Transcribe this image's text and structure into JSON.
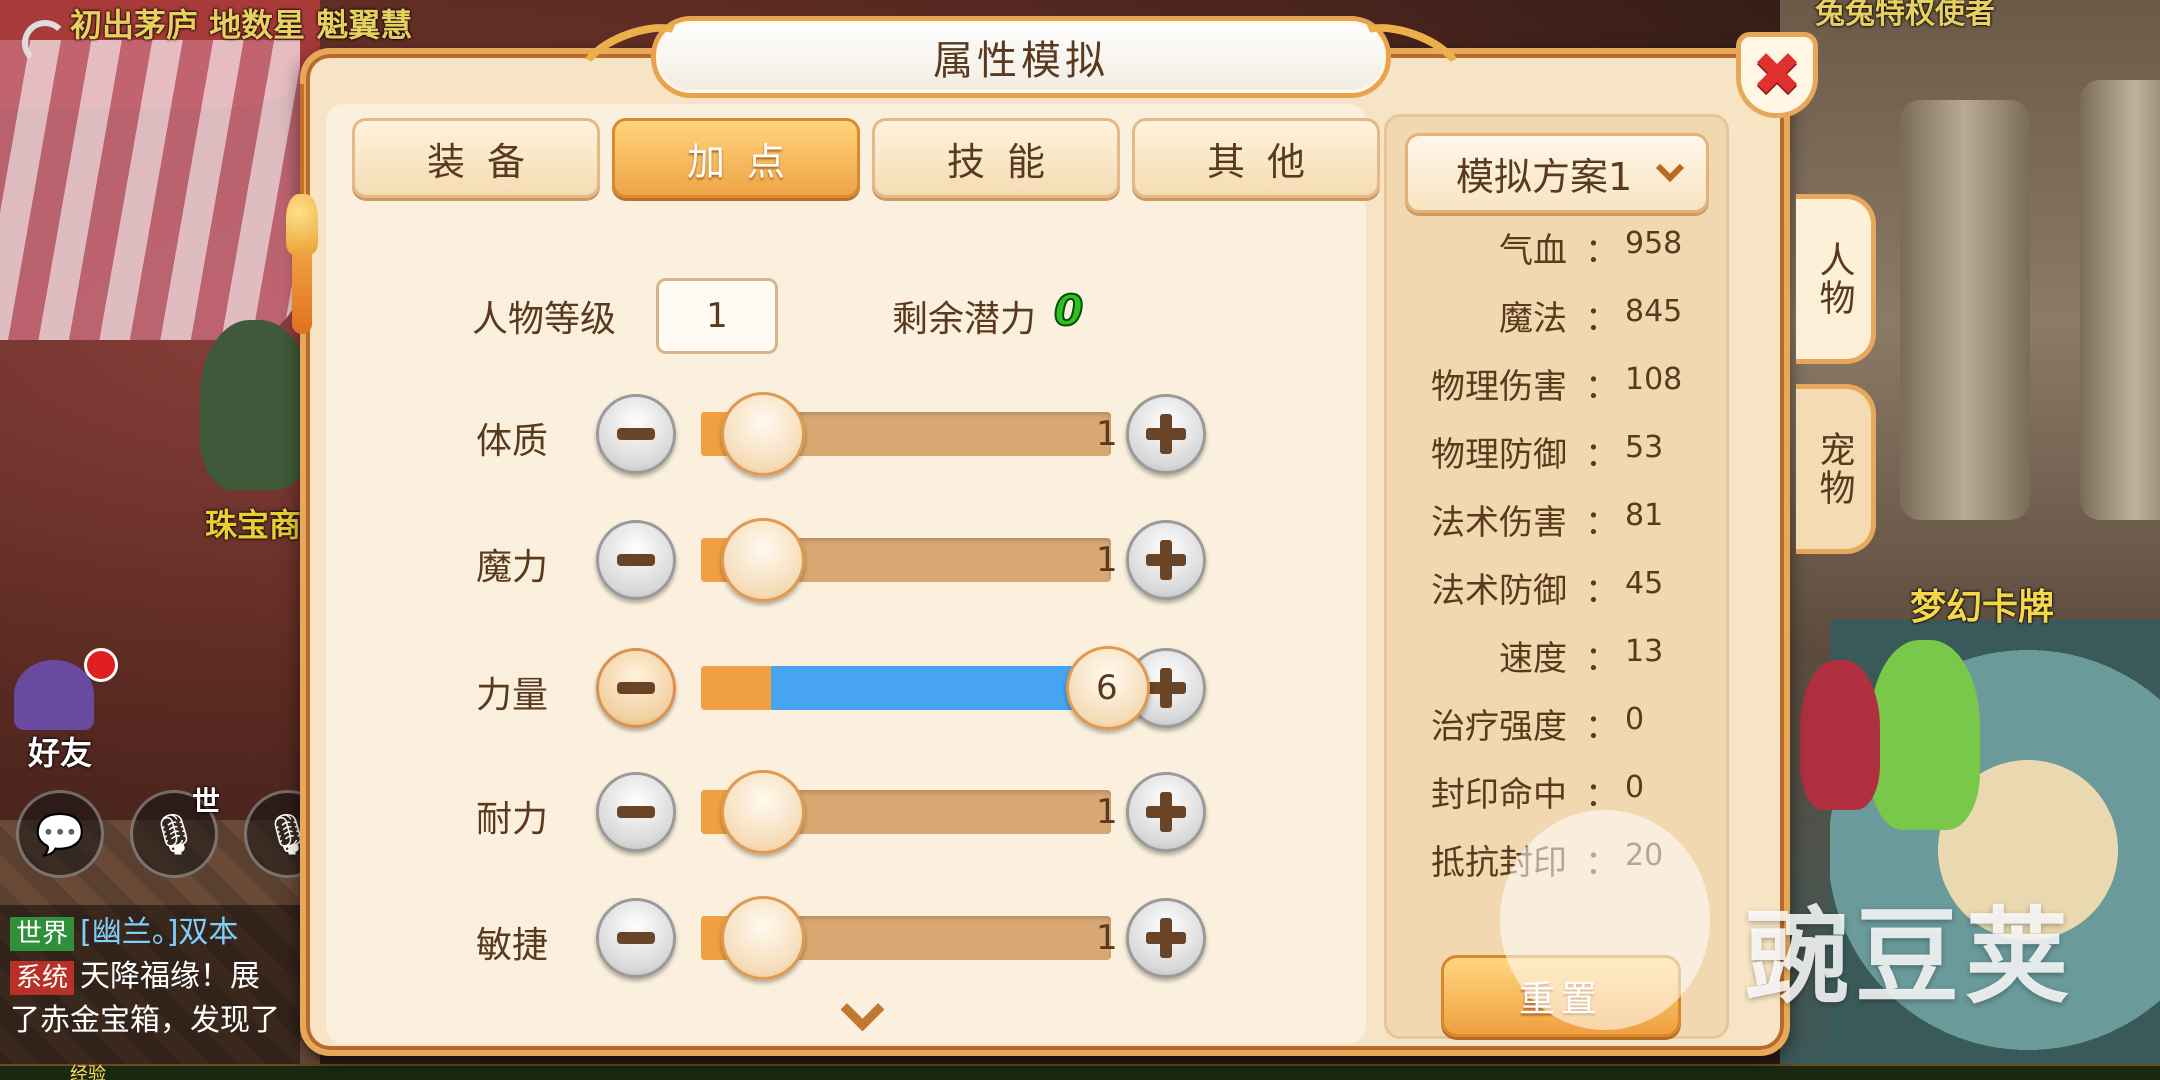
{
  "scene": {
    "top_left_banner": "初出茅庐 地数星 魁翼慧",
    "npc_jeweler": "珠宝商",
    "npc_card": "梦幻卡牌",
    "npc_top_right": "兔兔特权使者",
    "friend_label": "好友",
    "voice_world_label": "世",
    "chat": [
      {
        "tag": "世界",
        "tag_color": "#2f8f3a",
        "text": "[幽兰。]双本"
      },
      {
        "tag": "系统",
        "tag_color": "#b83028",
        "text": "天降福缘！展"
      },
      {
        "tag": "",
        "tag_color": "",
        "text": "了赤金宝箱，发现了"
      }
    ],
    "exp_label": "经验"
  },
  "dialog": {
    "title": "属性模拟",
    "close_symbol": "✖",
    "tabs": [
      {
        "label": "装备",
        "active": false
      },
      {
        "label": "加点",
        "active": true
      },
      {
        "label": "技能",
        "active": false
      },
      {
        "label": "其他",
        "active": false
      }
    ],
    "level_label": "人物等级",
    "level_value": "1",
    "remaining_label": "剩余潜力",
    "remaining_value": "0",
    "attributes": [
      {
        "name": "体质",
        "value": "1"
      },
      {
        "name": "魔力",
        "value": "1"
      },
      {
        "name": "力量",
        "value": "6"
      },
      {
        "name": "耐力",
        "value": "1"
      },
      {
        "name": "敏捷",
        "value": "1"
      }
    ],
    "plan_select": "模拟方案1",
    "stats": [
      {
        "key": "气血",
        "value": "958"
      },
      {
        "key": "魔法",
        "value": "845"
      },
      {
        "key": "物理伤害",
        "value": "108"
      },
      {
        "key": "物理防御",
        "value": "53"
      },
      {
        "key": "法术伤害",
        "value": "81"
      },
      {
        "key": "法术防御",
        "value": "45"
      },
      {
        "key": "速度",
        "value": "13"
      },
      {
        "key": "治疗强度",
        "value": "0"
      },
      {
        "key": "封印命中",
        "value": "0"
      },
      {
        "key": "抵抗封印",
        "value": "20"
      }
    ],
    "stat_separator": "：",
    "reset_label": "重置",
    "side_tabs": [
      {
        "label": "人物",
        "active": true
      },
      {
        "label": "宠物",
        "active": false
      }
    ]
  },
  "watermark": "豌豆荚",
  "colors": {
    "accent_orange": "#f0a040",
    "slider_blue": "#46a4f0",
    "close_red": "#e03030",
    "remaining_green": "#30c020"
  }
}
